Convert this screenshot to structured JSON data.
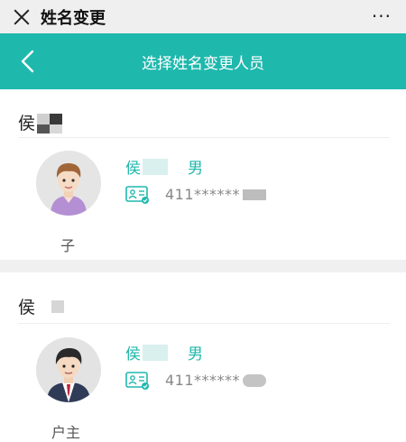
{
  "topbar": {
    "title": "姓名变更",
    "more": "···"
  },
  "header": {
    "title": "选择姓名变更人员"
  },
  "households": [
    {
      "name": "侯",
      "member": {
        "name": "侯",
        "gender": "男",
        "id_number": "411******",
        "relation": "子"
      }
    },
    {
      "name": "侯",
      "member": {
        "name": "侯",
        "gender": "男",
        "id_number": "411******",
        "relation": "户主"
      }
    }
  ],
  "colors": {
    "accent": "#1fb8ad",
    "topbar": "#efefef",
    "gap": "#f0f0f0"
  }
}
